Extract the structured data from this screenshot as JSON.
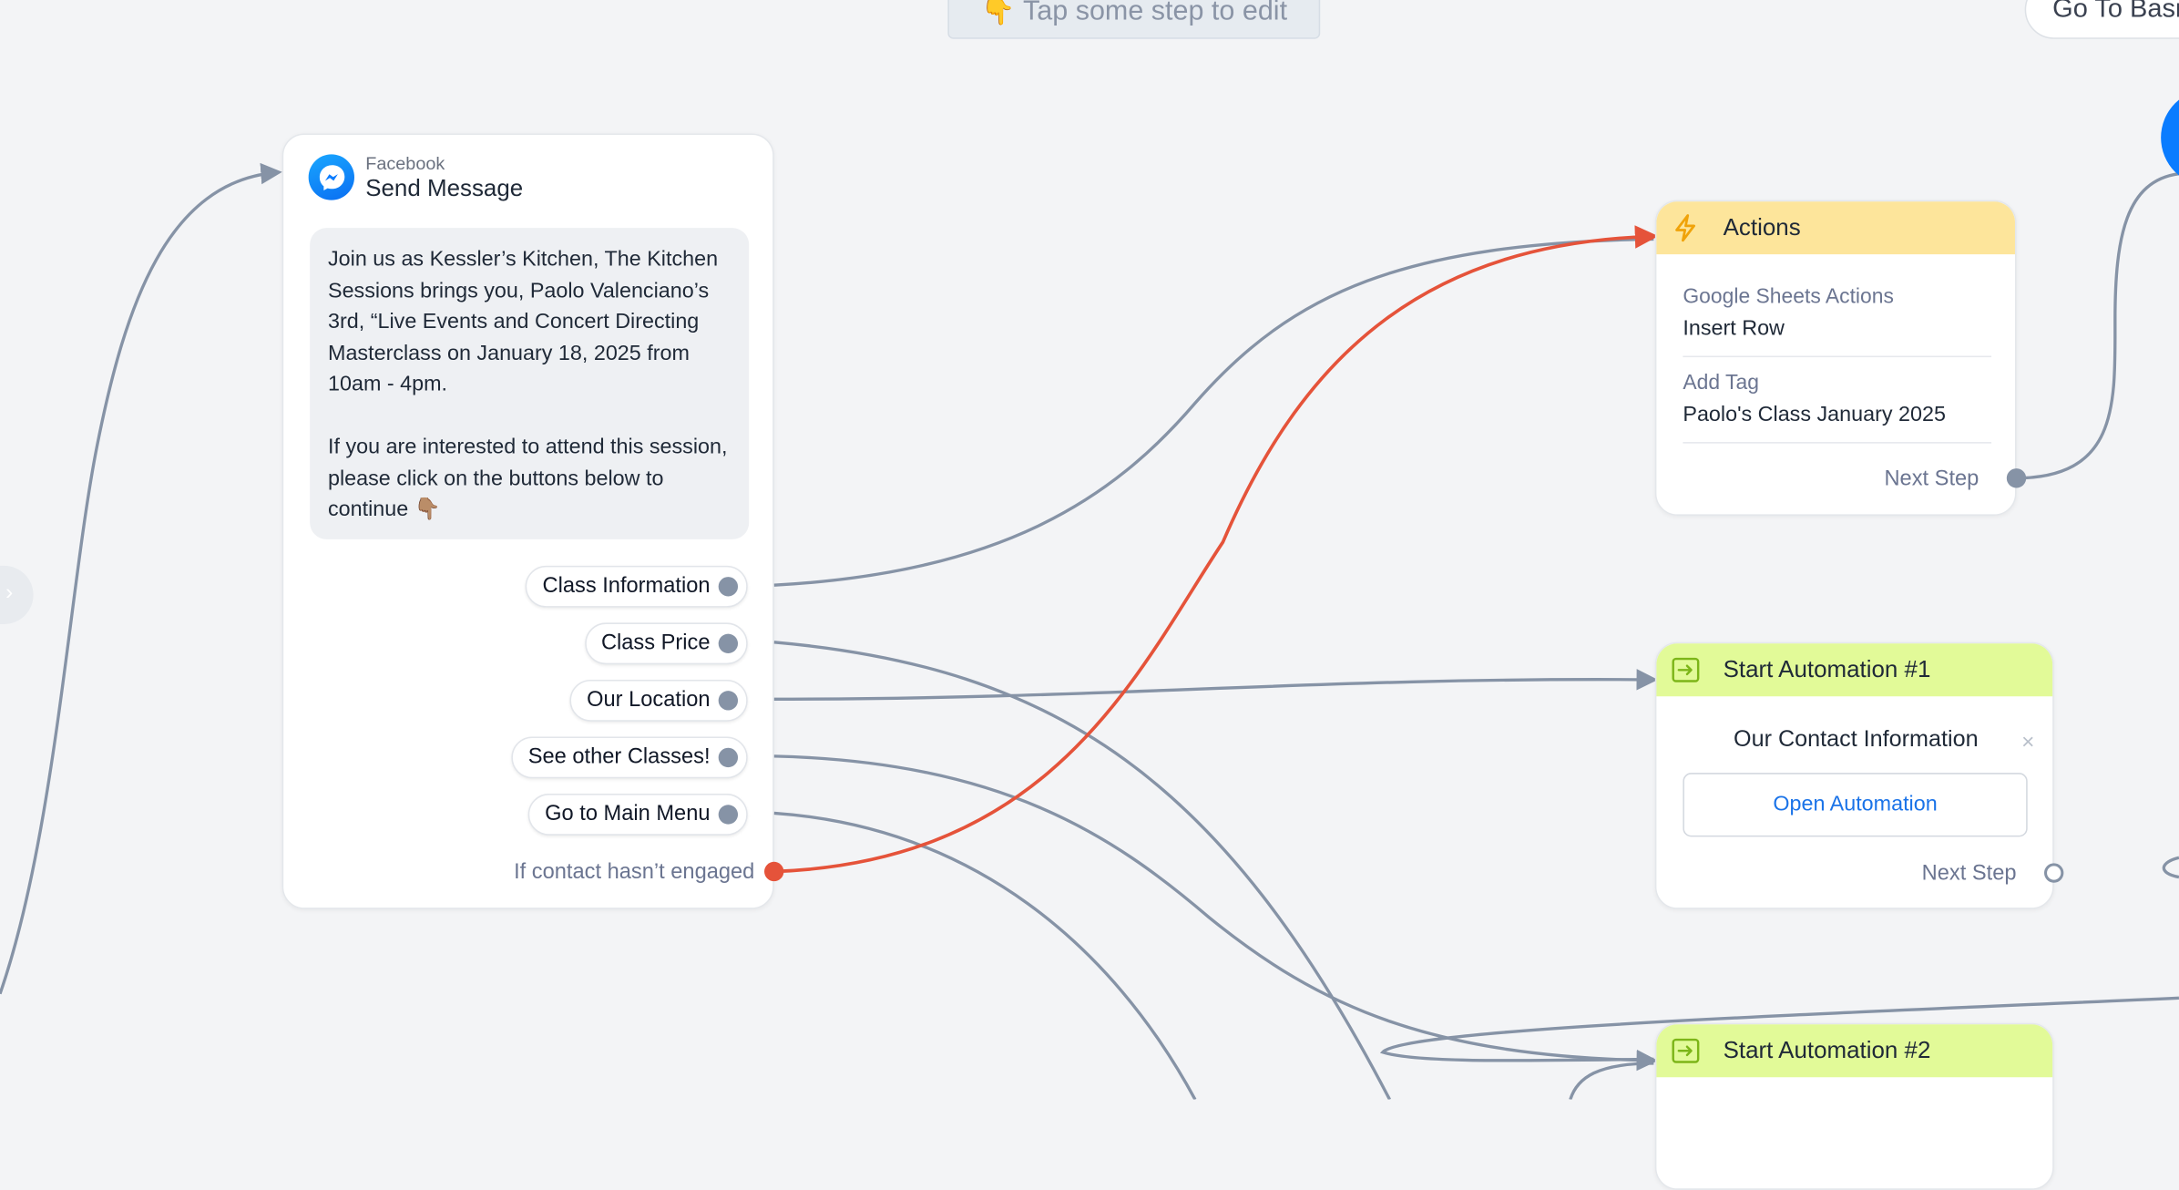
{
  "top": {
    "hint_emoji": "👇",
    "hint_text": "Tap some step to edit",
    "go_basic_label": "Go To Basi"
  },
  "send_message": {
    "source": "Facebook",
    "title": "Send Message",
    "paragraph_1": "Join us as Kessler’s Kitchen, The Kitchen Sessions brings you, Paolo Valenciano’s 3rd, “Live Events and Concert Directing Masterclass on January 18, 2025 from 10am - 4pm.",
    "paragraph_2": "If you are interested to attend this session, please click on the buttons below to continue 👇🏽",
    "buttons": [
      {
        "label": "Class Information"
      },
      {
        "label": "Class Price"
      },
      {
        "label": "Our Location"
      },
      {
        "label": "See other Classes!"
      },
      {
        "label": "Go to Main Menu"
      }
    ],
    "not_engaged_label": "If contact hasn’t engaged"
  },
  "actions": {
    "title": "Actions",
    "items": [
      {
        "label": "Google Sheets Actions",
        "value": "Insert Row"
      },
      {
        "label": "Add Tag",
        "value": "Paolo's Class January 2025"
      }
    ],
    "next_step_label": "Next Step"
  },
  "automation_1": {
    "title": "Start Automation #1",
    "automation_name": "Our Contact Information",
    "close_symbol": "×",
    "open_label": "Open Automation",
    "next_step_label": "Next Step"
  },
  "automation_2": {
    "title": "Start Automation #2"
  },
  "colors": {
    "canvas_bg": "#f3f4f6",
    "wire": "#8693a6",
    "wire_not_engaged": "#e5533a",
    "actions_header": "#fde59b",
    "automation_header": "#e2fa98",
    "link_blue": "#1a73e8"
  },
  "icons": {
    "messenger": "messenger-icon",
    "actions": "lightning-icon",
    "automation": "start-automation-icon",
    "side_handle": "chevron-right-icon"
  }
}
